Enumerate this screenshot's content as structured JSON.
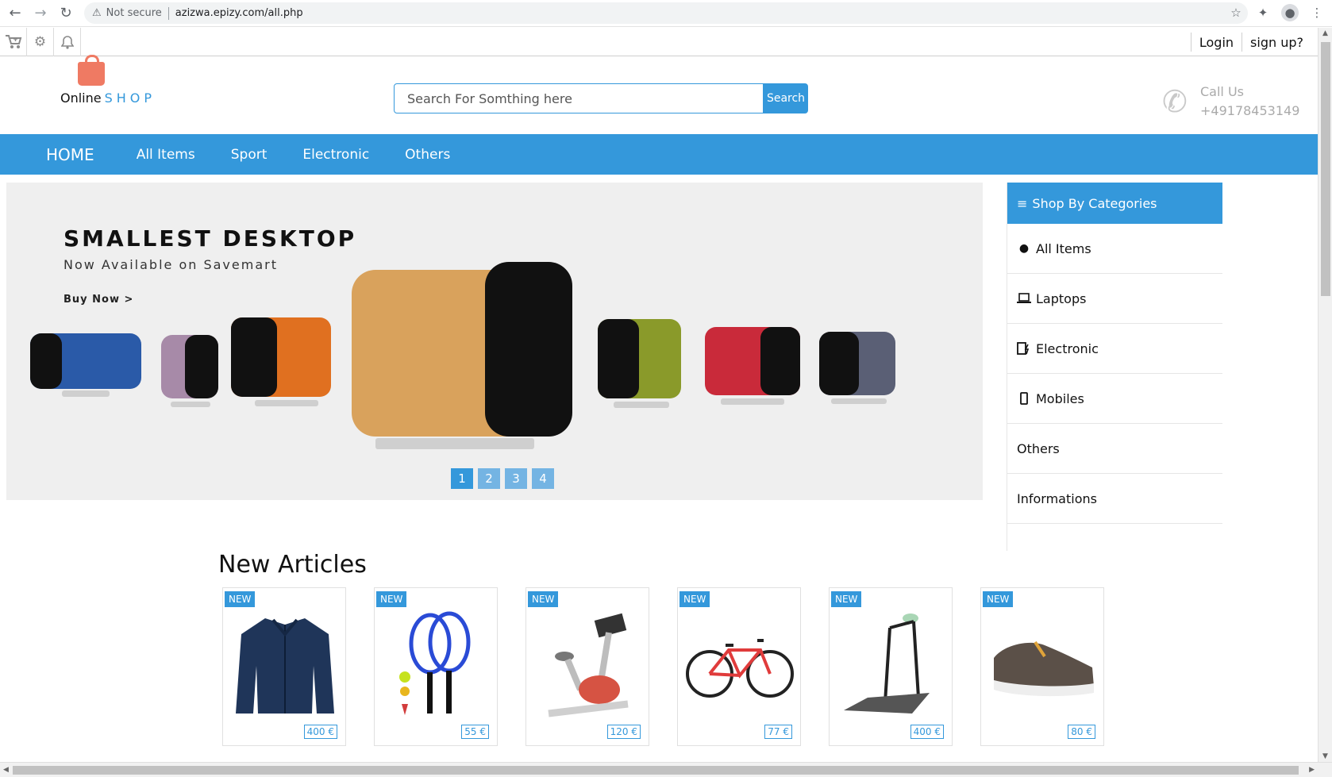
{
  "browser": {
    "security_label": "Not secure",
    "url": "azizwa.epizy.com/all.php"
  },
  "utilbar": {
    "login": "Login",
    "signup": "sign up?"
  },
  "header": {
    "logo_online": "Online",
    "logo_shop": "SHOP",
    "search_placeholder": "Search For Somthing here",
    "search_button": "Search",
    "call_label": "Call Us",
    "call_number": "+49178453149"
  },
  "nav": {
    "items": [
      "HOME",
      "All Items",
      "Sport",
      "Electronic",
      "Others"
    ]
  },
  "hero": {
    "title": "SMALLEST DESKTOP",
    "subtitle": "Now Available on Savemart",
    "cta": "Buy Now  >",
    "slides": [
      "1",
      "2",
      "3",
      "4"
    ],
    "active_slide": 1
  },
  "categories": {
    "heading": "Shop By Categories",
    "items": [
      {
        "label": "All Items",
        "icon": "globe-icon"
      },
      {
        "label": "Laptops",
        "icon": "laptop-icon"
      },
      {
        "label": "Electronic",
        "icon": "electronics-icon"
      },
      {
        "label": "Mobiles",
        "icon": "mobile-icon"
      },
      {
        "label": "Others",
        "icon": ""
      },
      {
        "label": "Informations",
        "icon": ""
      }
    ]
  },
  "articles": {
    "title": "New Articles",
    "badge": "NEW",
    "items": [
      {
        "product": "jacket",
        "price": "400 €"
      },
      {
        "product": "tennis-rackets",
        "price": "55 €"
      },
      {
        "product": "exercise-bike",
        "price": "120 €"
      },
      {
        "product": "bicycle",
        "price": "77 €"
      },
      {
        "product": "treadmill",
        "price": "400 €"
      },
      {
        "product": "sneaker",
        "price": "80 €"
      }
    ]
  },
  "colors": {
    "accent": "#3498db",
    "logo_bag": "#ef7a63"
  }
}
